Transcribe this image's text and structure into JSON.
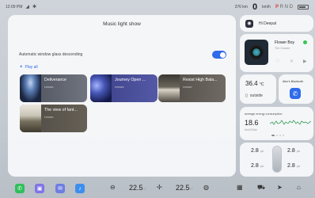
{
  "status_bar": {
    "time": "12:09 PM",
    "range": "376 km",
    "speed": "0",
    "speed_unit": "km/h",
    "gears": [
      "P",
      "R",
      "N",
      "D"
    ]
  },
  "main": {
    "title": "Music light show",
    "setting_label": "Automatic window glass descending",
    "setting_on": true,
    "play_all": "Play all",
    "cards": [
      {
        "title": "Deliverance",
        "sub": "Lenovo"
      },
      {
        "title": "Journey Open ...",
        "sub": "Lenovo"
      },
      {
        "title": "Resist High Bala...",
        "sub": "Lenovo"
      },
      {
        "title": "The view of fant...",
        "sub": "Lenovo"
      }
    ]
  },
  "user": {
    "name": "Hi Deepal"
  },
  "music": {
    "song": "Flower Boy",
    "artist": "The Creator"
  },
  "climate": {
    "temp": "36.4",
    "unit": "°C",
    "label": "outside"
  },
  "bluetooth": {
    "label": "Alex's Bluetooth"
  },
  "energy": {
    "label": "average energy consumption",
    "value": "18.6",
    "unit": "kwh/100km"
  },
  "tires": {
    "fl": "2.8",
    "fr": "2.8",
    "rl": "2.8",
    "rr": "2.8",
    "unit": "psi"
  },
  "dock": {
    "temp_left": "22.5",
    "temp_right": "22.5",
    "temp_unit": "°C"
  },
  "colors": {
    "accent": "#2f6bea",
    "green": "#34c759",
    "red": "#e03a3a"
  }
}
